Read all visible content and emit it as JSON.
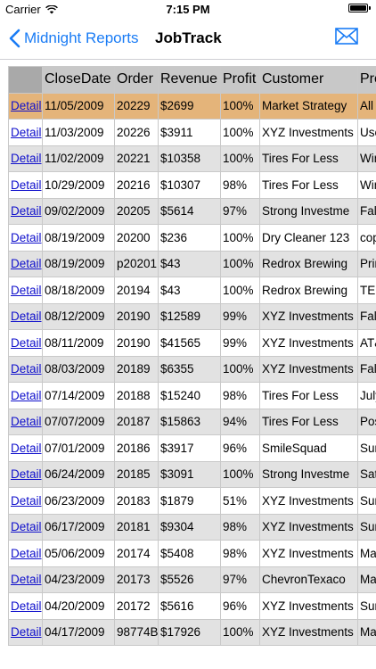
{
  "status_bar": {
    "carrier": "Carrier",
    "time": "7:15 PM",
    "battery_level": 1.0
  },
  "nav": {
    "back_label": "Midnight Reports",
    "title": "JobTrack",
    "mail_icon": "envelope-icon",
    "accent_color": "#1a7cf5"
  },
  "table": {
    "headers": [
      "",
      "CloseDate",
      "Order",
      "Revenue",
      "Profit",
      "Customer",
      "Pro"
    ],
    "selected_row_index": 0,
    "selected_color": "#e4b47a",
    "rows": [
      {
        "link": "Detail",
        "date": "11/05/2009",
        "order": "20229",
        "revenue": "$2699",
        "profit": "100%",
        "customer": "Market Strategy",
        "product": "All S"
      },
      {
        "link": "Detail",
        "date": "11/03/2009",
        "order": "20226",
        "revenue": "$3911",
        "profit": "100%",
        "customer": "XYZ Investments",
        "product": "Use"
      },
      {
        "link": "Detail",
        "date": "11/02/2009",
        "order": "20221",
        "revenue": "$10358",
        "profit": "100%",
        "customer": "Tires For Less",
        "product": "Win"
      },
      {
        "link": "Detail",
        "date": "10/29/2009",
        "order": "20216",
        "revenue": "$10307",
        "profit": "98%",
        "customer": "Tires For Less",
        "product": "Win"
      },
      {
        "link": "Detail",
        "date": "09/02/2009",
        "order": "20205",
        "revenue": "$5614",
        "profit": "97%",
        "customer": "Strong Investme",
        "product": "Fall"
      },
      {
        "link": "Detail",
        "date": "08/19/2009",
        "order": "20200",
        "revenue": "$236",
        "profit": "100%",
        "customer": "Dry Cleaner 123",
        "product": "cop"
      },
      {
        "link": "Detail",
        "date": "08/19/2009",
        "order": "p20201",
        "revenue": "$43",
        "profit": "100%",
        "customer": "Redrox Brewing",
        "product": "Prin"
      },
      {
        "link": "Detail",
        "date": "08/18/2009",
        "order": "20194",
        "revenue": "$43",
        "profit": "100%",
        "customer": "Redrox Brewing",
        "product": "TEM"
      },
      {
        "link": "Detail",
        "date": "08/12/2009",
        "order": "20190",
        "revenue": "$12589",
        "profit": "99%",
        "customer": "XYZ Investments",
        "product": "Fall"
      },
      {
        "link": "Detail",
        "date": "08/11/2009",
        "order": "20190",
        "revenue": "$41565",
        "profit": "99%",
        "customer": "XYZ Investments",
        "product": "AT&"
      },
      {
        "link": "Detail",
        "date": "08/03/2009",
        "order": "20189",
        "revenue": "$6355",
        "profit": "100%",
        "customer": "XYZ Investments",
        "product": "Fall"
      },
      {
        "link": "Detail",
        "date": "07/14/2009",
        "order": "20188",
        "revenue": "$15240",
        "profit": "98%",
        "customer": "Tires For Less",
        "product": "July"
      },
      {
        "link": "Detail",
        "date": "07/07/2009",
        "order": "20187",
        "revenue": "$15863",
        "profit": "94%",
        "customer": "Tires For Less",
        "product": "Pos"
      },
      {
        "link": "Detail",
        "date": "07/01/2009",
        "order": "20186",
        "revenue": "$3917",
        "profit": "96%",
        "customer": "SmileSquad",
        "product": "Sur"
      },
      {
        "link": "Detail",
        "date": "06/24/2009",
        "order": "20185",
        "revenue": "$3091",
        "profit": "100%",
        "customer": "Strong Investme",
        "product": "Sat"
      },
      {
        "link": "Detail",
        "date": "06/23/2009",
        "order": "20183",
        "revenue": "$1879",
        "profit": "51%",
        "customer": "XYZ Investments",
        "product": "Sur"
      },
      {
        "link": "Detail",
        "date": "06/17/2009",
        "order": "20181",
        "revenue": "$9304",
        "profit": "98%",
        "customer": "XYZ Investments",
        "product": "Sur"
      },
      {
        "link": "Detail",
        "date": "05/06/2009",
        "order": "20174",
        "revenue": "$5408",
        "profit": "98%",
        "customer": "XYZ Investments",
        "product": "May"
      },
      {
        "link": "Detail",
        "date": "04/23/2009",
        "order": "20173",
        "revenue": "$5526",
        "profit": "97%",
        "customer": "ChevronTexaco",
        "product": "May"
      },
      {
        "link": "Detail",
        "date": "04/20/2009",
        "order": "20172",
        "revenue": "$5616",
        "profit": "96%",
        "customer": "XYZ Investments",
        "product": "Sur"
      },
      {
        "link": "Detail",
        "date": "04/17/2009",
        "order": "98774B",
        "revenue": "$17926",
        "profit": "100%",
        "customer": "XYZ Investments",
        "product": "May"
      }
    ]
  }
}
